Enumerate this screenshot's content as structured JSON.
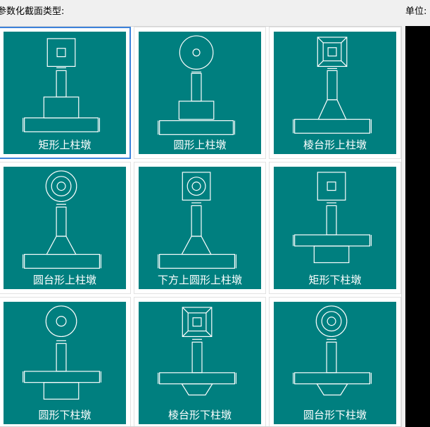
{
  "header": {
    "section_label": "参数化截面类型:",
    "unit_label": "单位:"
  },
  "tiles": [
    {
      "label": "矩形上柱墩",
      "top": "square",
      "icon": "rect-upper-pier-icon"
    },
    {
      "label": "圆形上柱墩",
      "top": "circle",
      "icon": "round-upper-pier-icon"
    },
    {
      "label": "棱台形上柱墩",
      "top": "frustum-square",
      "icon": "frustum-upper-pier-icon"
    },
    {
      "label": "圆台形上柱墩",
      "top": "double-circle",
      "icon": "cone-frustum-upper-pier-icon"
    },
    {
      "label": "下方上圆形上柱墩",
      "top": "square-circle",
      "icon": "square-bottom-round-top-upper-pier-icon"
    },
    {
      "label": "矩形下柱墩",
      "top": "square",
      "icon": "rect-lower-pier-icon"
    },
    {
      "label": "圆形下柱墩",
      "top": "circle",
      "icon": "round-lower-pier-icon"
    },
    {
      "label": "棱台形下柱墩",
      "top": "frustum-square",
      "icon": "frustum-lower-pier-icon"
    },
    {
      "label": "圆台形下柱墩",
      "top": "double-circle",
      "icon": "cone-frustum-lower-pier-icon"
    }
  ],
  "selected_index": 0,
  "colors": {
    "tile_bg": "#007f7f",
    "selection": "#3c82db",
    "line": "#ffffff",
    "preview_bg": "#000000"
  }
}
